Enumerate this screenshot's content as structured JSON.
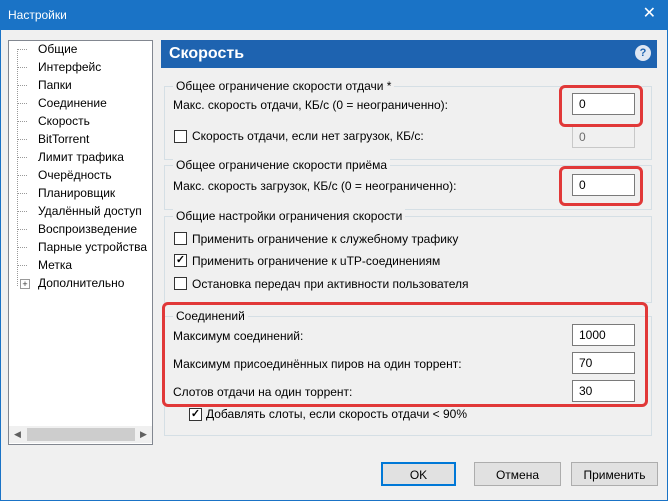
{
  "window": {
    "title": "Настройки",
    "close_glyph": "✕"
  },
  "tree": {
    "items": [
      {
        "label": "Общие"
      },
      {
        "label": "Интерфейс"
      },
      {
        "label": "Папки"
      },
      {
        "label": "Соединение"
      },
      {
        "label": "Скорость"
      },
      {
        "label": "BitTorrent"
      },
      {
        "label": "Лимит трафика"
      },
      {
        "label": "Очерёдность"
      },
      {
        "label": "Планировщик"
      },
      {
        "label": "Удалённый доступ"
      },
      {
        "label": "Воспроизведение"
      },
      {
        "label": "Парные устройства"
      },
      {
        "label": "Метка"
      },
      {
        "label": "Дополнительно"
      }
    ],
    "scroll_left": "◀",
    "scroll_right": "▶"
  },
  "panel": {
    "title": "Скорость",
    "help": "?"
  },
  "upload_group": {
    "label": "Общее ограничение скорости отдачи *",
    "max_label": "Макс. скорость отдачи, КБ/с (0 = неограниченно):",
    "max_value": "0",
    "no_download_label": "Скорость отдачи, если нет загрузок, КБ/с:",
    "no_download_value": "0"
  },
  "download_group": {
    "label": "Общее ограничение скорости приёма",
    "max_label": "Макс. скорость загрузок, КБ/с (0 = неограниченно):",
    "max_value": "0"
  },
  "general_group": {
    "label": "Общие настройки ограничения скорости",
    "opt1": "Применить ограничение к служебному трафику",
    "opt2": "Применить ограничение к uTP-соединениям",
    "opt3": "Остановка передач при активности пользователя",
    "check_glyph": "✓"
  },
  "connections_group": {
    "label": "Соединений",
    "max_conn_label": "Максимум соединений:",
    "max_conn_value": "1000",
    "max_peers_label": "Максимум присоединённых пиров на один торрент:",
    "max_peers_value": "70",
    "slots_label": "Слотов отдачи на один торрент:",
    "slots_value": "30",
    "extra_slots_label": "Добавлять слоты, если скорость отдачи < 90%"
  },
  "buttons": {
    "ok": "OK",
    "cancel": "Отмена",
    "apply": "Применить"
  },
  "colors": {
    "title_bar": "#1a73c6",
    "panel_header": "#1e63b0",
    "highlight": "#e13838"
  }
}
